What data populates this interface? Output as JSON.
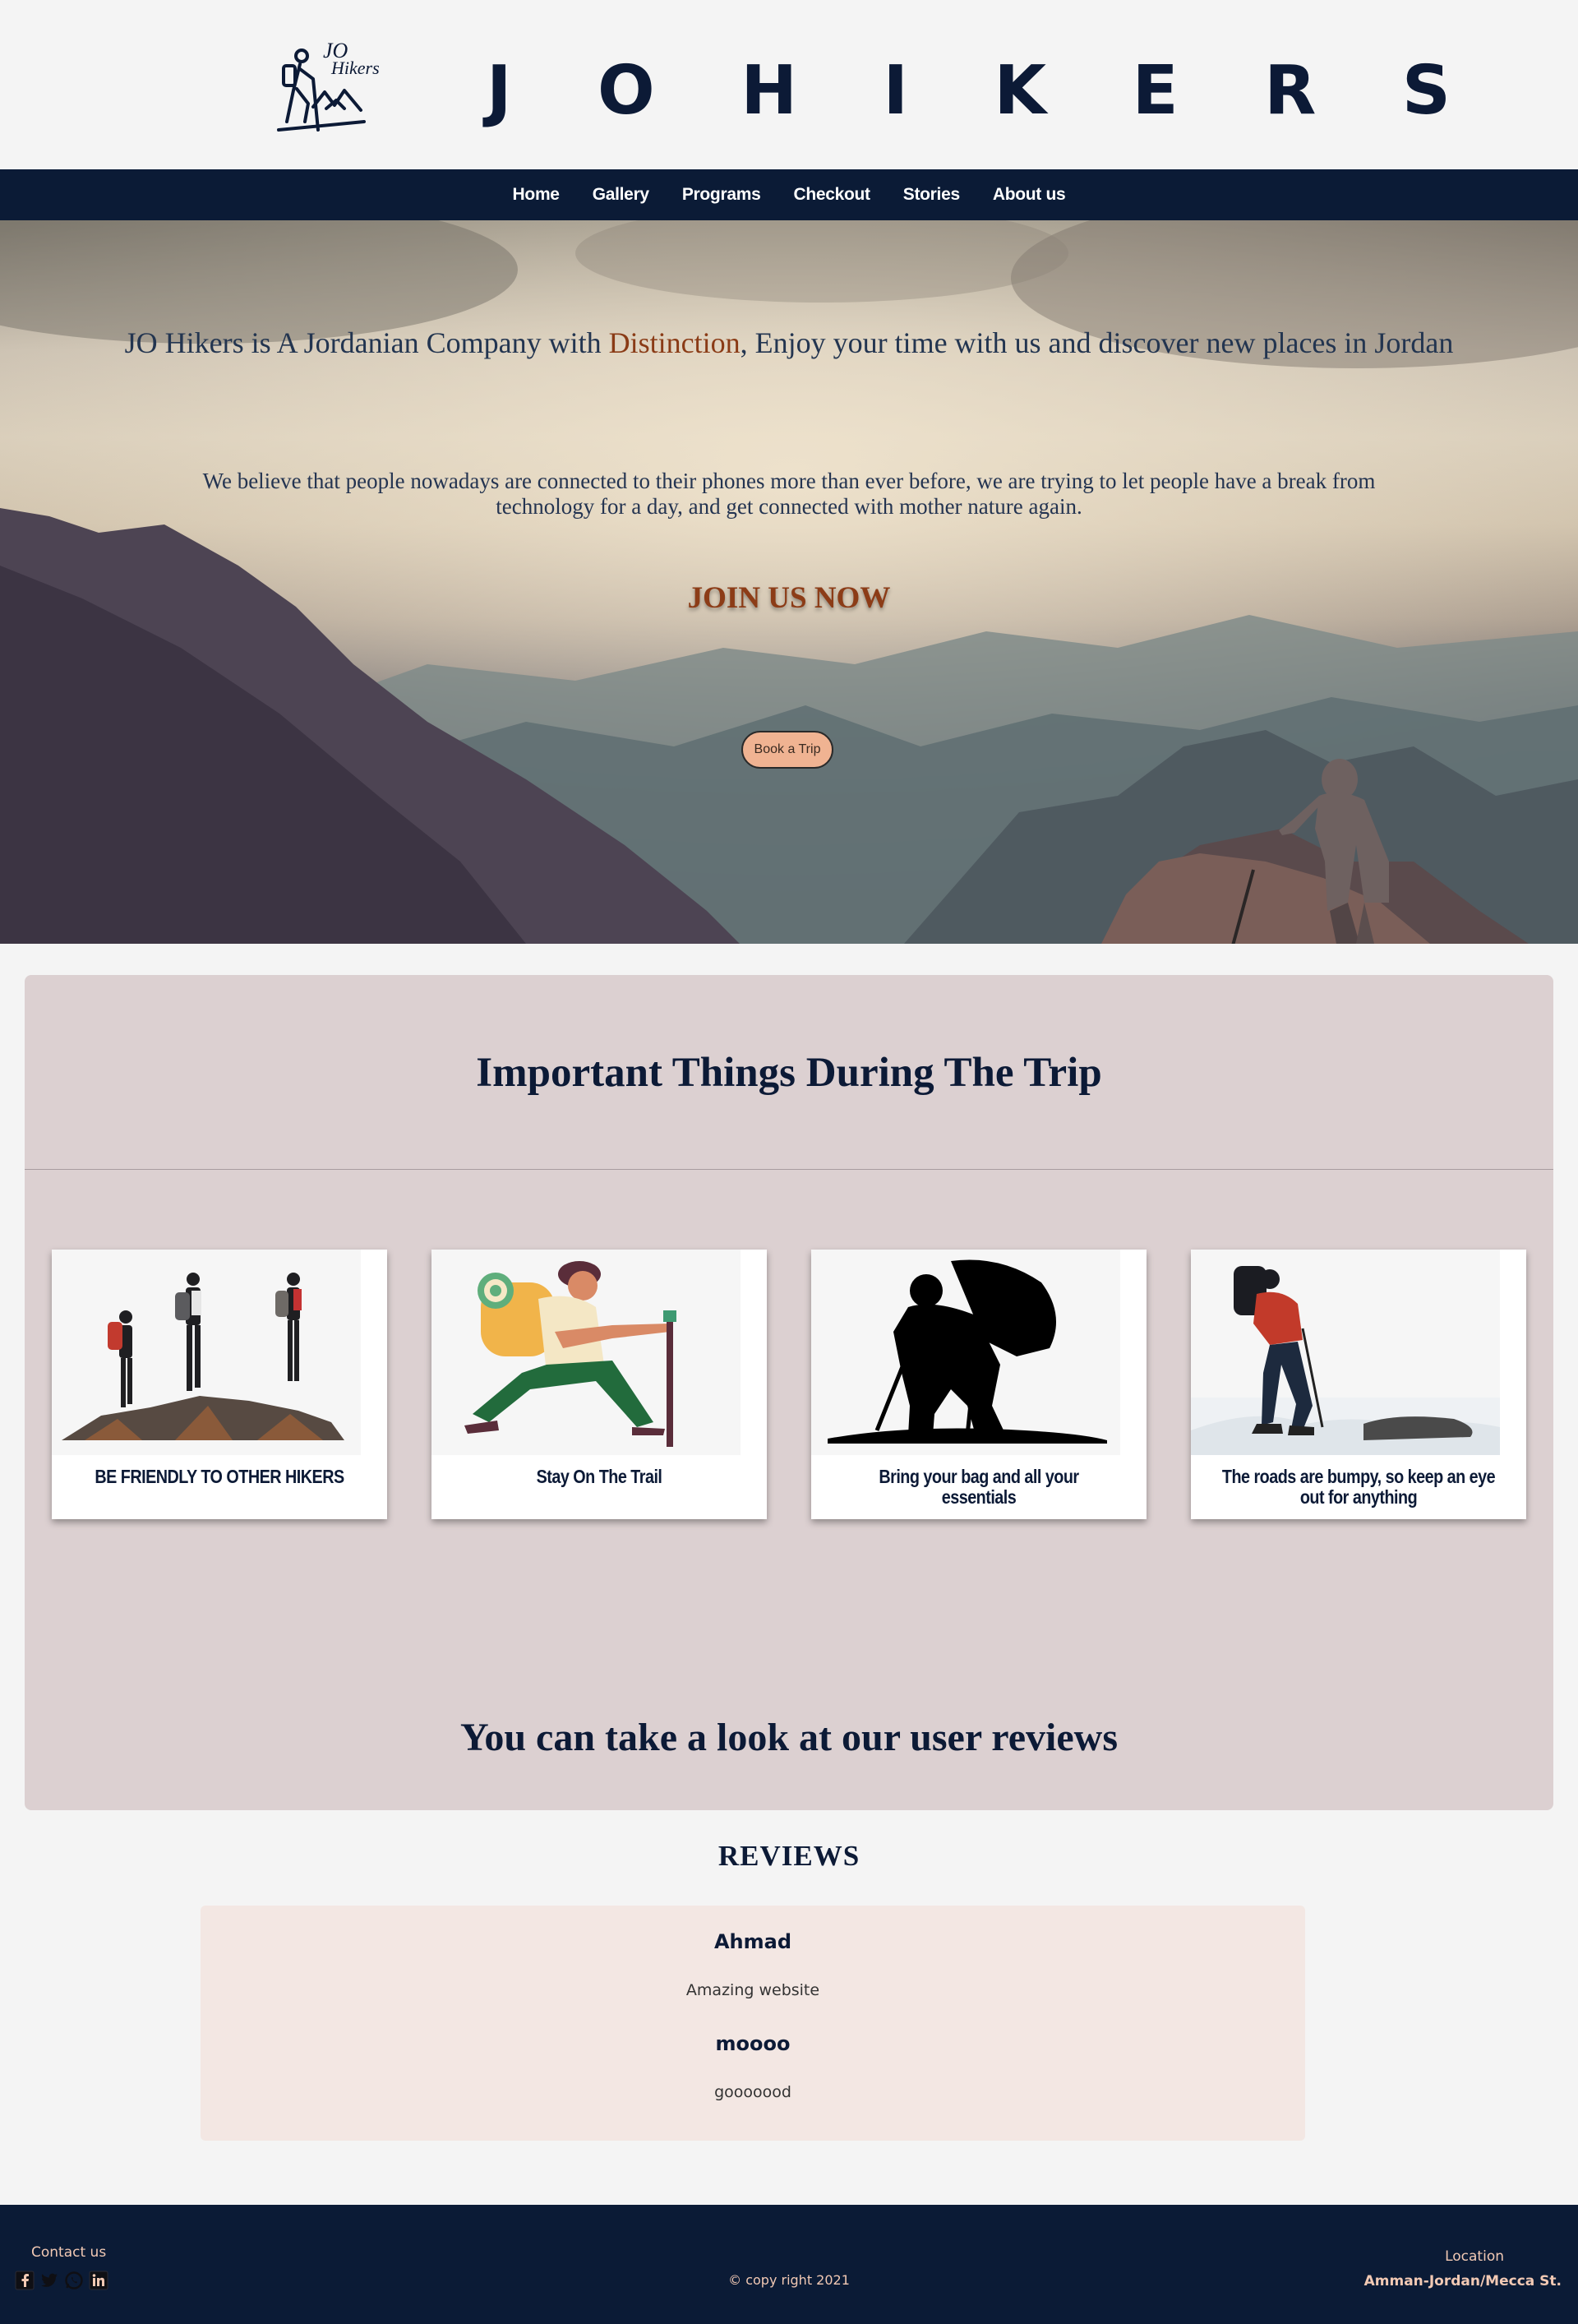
{
  "brand": {
    "logo_text_top": "JO",
    "logo_text_bottom": "Hikers",
    "title": "J O   H I K E R S"
  },
  "nav": {
    "items": [
      "Home",
      "Gallery",
      "Programs",
      "Checkout",
      "Stories",
      "About us"
    ]
  },
  "hero": {
    "title_before": "JO Hikers is A Jordanian Company with ",
    "title_accent": "Distinction",
    "title_after": ", Enjoy your time with us and discover new places in Jordan",
    "subtitle": "We believe that people nowadays are connected to their phones more than ever before, we are trying to let people have a break from technology for a day, and get connected with mother nature again.",
    "cta": "JOIN US NOW",
    "book_button": "Book a Trip"
  },
  "important": {
    "title": "Important Things During The Trip",
    "cards": [
      {
        "caption": "BE FRIENDLY TO OTHER HIKERS"
      },
      {
        "caption": "Stay On The Trail"
      },
      {
        "caption": "Bring your bag and all your essentials"
      },
      {
        "caption": "The roads are bumpy, so keep an eye out for anything"
      }
    ],
    "reviews_prompt": "You can take a look at our user reviews"
  },
  "reviews": {
    "heading": "REVIEWS",
    "items": [
      {
        "name": "Ahmad",
        "text": "Amazing website"
      },
      {
        "name": "moooo",
        "text": "gooooood"
      }
    ]
  },
  "footer": {
    "contact": "Contact us",
    "socials": [
      "facebook-icon",
      "twitter-icon",
      "whatsapp-icon",
      "linkedin-icon"
    ],
    "copyright": "© copy right 2021",
    "location_label": "Location",
    "location_value": "Amman-Jordan/Mecca St."
  },
  "colors": {
    "navy": "#0b1b36",
    "accent": "#8a3b16",
    "button": "#f0b392",
    "panel": "#dcd0d1",
    "review_box": "#f3e7e3",
    "footer_text": "#f2c9b4"
  }
}
